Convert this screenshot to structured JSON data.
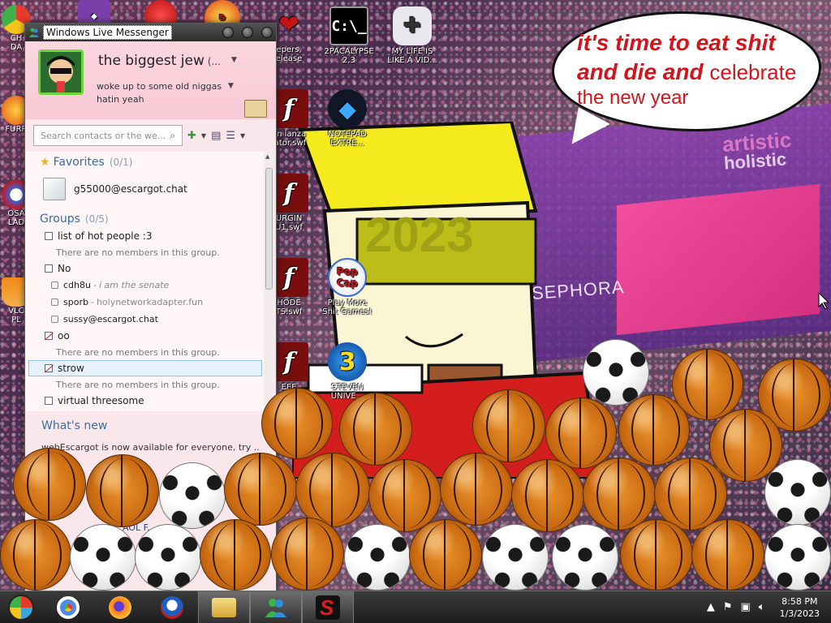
{
  "wallpaper": {
    "billboard_text_1": "artistic",
    "billboard_text_2": "holistic",
    "billboard_sephora": "SEPHORA",
    "year_text": "2023",
    "speech_bubble": {
      "line1": "it's time to eat shit",
      "line2_bold": "and die and",
      "line2_plain": "celebrate",
      "line3": "the new year"
    }
  },
  "desktop_icons": [
    {
      "id": "cmd",
      "label": "2PACALYPSE\n2.3",
      "glyph": "C:\\_",
      "icon": "cmd-icon"
    },
    {
      "id": "gamepad",
      "label": "MY LIFE IS\nLIKE A VID...",
      "glyph": "🎮",
      "icon": "gamepad-icon"
    },
    {
      "id": "flash1",
      "label": "epers,\nelease",
      "glyph": "",
      "icon": "flash-icon"
    },
    {
      "id": "flash2",
      "label": "nn lanza\nlator.swf",
      "glyph": "f",
      "icon": "flash-icon"
    },
    {
      "id": "notepad",
      "label": "NOTEPAD\nEXTRE...",
      "glyph": "◆",
      "icon": "notepad-extreme-icon"
    },
    {
      "id": "flash3",
      "label": "URGIN\nU1.swf",
      "glyph": "f",
      "icon": "flash-icon"
    },
    {
      "id": "flash4",
      "label": "HODE\nTS.swf",
      "glyph": "f",
      "icon": "flash-icon"
    },
    {
      "id": "popcap",
      "label": "Play More\nShit Games!",
      "glyph": "Pop\nCap",
      "icon": "popcap-icon"
    },
    {
      "id": "flash5",
      "label": "EEE",
      "glyph": "f",
      "icon": "flash-icon"
    },
    {
      "id": "steven",
      "label": "STEVEN\nUNIVE...",
      "glyph": "3",
      "icon": "steven-universe-icon"
    }
  ],
  "edge_icons": [
    {
      "label": "CH\nDA",
      "color": "#e7a02a"
    },
    {
      "label": "FURR",
      "color": "#e4521f"
    },
    {
      "label": "OSA\nLAD",
      "color": "#3b5fd6"
    },
    {
      "label": "VLC\nPL",
      "color": "#f08a16"
    }
  ],
  "messenger": {
    "window_title": "Windows Live Messenger",
    "display_name": "the biggest jew",
    "display_name_suffix": "(...",
    "personal_message_line1": "woke up to some old niggas",
    "personal_message_line2": "hatin yeah",
    "search_placeholder": "Search contacts or the we...",
    "favorites_label": "Favorites",
    "favorites_count": "(0/1)",
    "favorite_contacts": [
      "g55000@escargot.chat"
    ],
    "groups_label": "Groups",
    "groups_count": "(0/5)",
    "groups": [
      {
        "name": "list of hot people :3",
        "struck": false,
        "empty_text": "There are no members in this group.",
        "members": []
      },
      {
        "name": "No",
        "struck": false,
        "empty_text": "",
        "members": [
          {
            "name": "cdh8u",
            "psm": "i am the senate",
            "italic": true
          },
          {
            "name": "sporb",
            "psm": "holynetworkadapter.fun",
            "italic": false
          },
          {
            "name": "sussy@escargot.chat",
            "psm": "",
            "italic": false
          }
        ]
      },
      {
        "name": "oo",
        "struck": true,
        "empty_text": "There are no members in this group.",
        "members": []
      },
      {
        "name": "strow",
        "struck": true,
        "selected": true,
        "empty_text": "There are no members in this group.",
        "members": []
      },
      {
        "name": "virtual threesome",
        "struck": false,
        "empty_text": "",
        "members": []
      }
    ],
    "whats_new_title": "What's new",
    "whats_new_body": "webEscargot is now available for everyone, try ...",
    "aol_strip": "AOL F...  pro"
  },
  "taskbar": {
    "apps": [
      {
        "name": "chrome",
        "icon": "chrome-icon",
        "color": "#4c8bf5"
      },
      {
        "name": "firefox",
        "icon": "firefox-icon",
        "color": "#ff7a18"
      },
      {
        "name": "obama",
        "icon": "obama-logo-icon",
        "color": "#1f5fbf"
      },
      {
        "name": "explorer",
        "icon": "folder-icon",
        "color": "#e8c25a"
      },
      {
        "name": "messenger",
        "icon": "messenger-icon",
        "color": "#3aa24a"
      },
      {
        "name": "speed",
        "icon": "red-s-icon",
        "color": "#d21b1b"
      }
    ],
    "clock_time": "8:58 PM",
    "clock_date": "1/3/2023"
  }
}
